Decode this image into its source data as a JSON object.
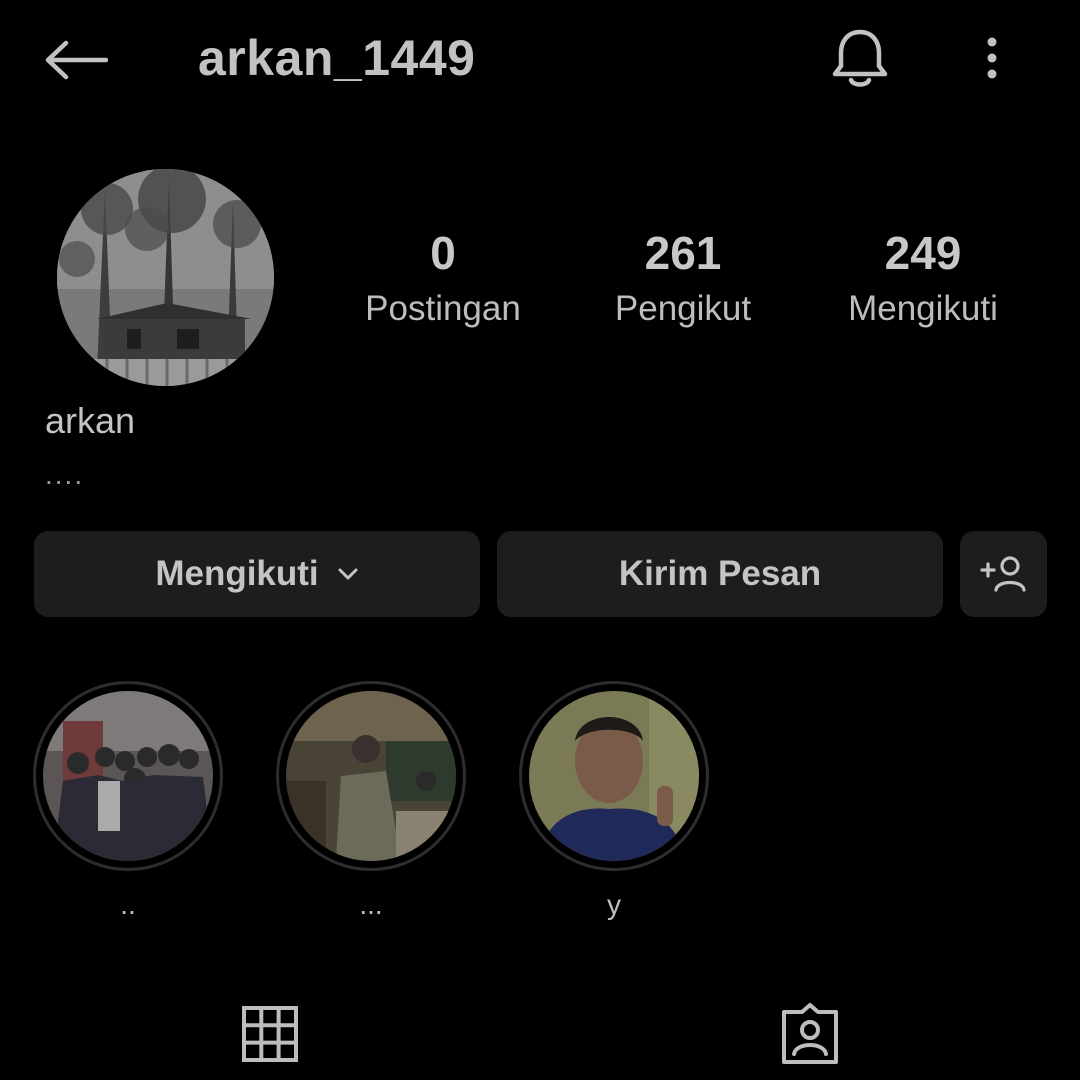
{
  "header": {
    "username": "arkan_1449",
    "icons": {
      "back": "arrow-left-icon",
      "bell": "bell-icon",
      "more": "more-vertical-icon"
    }
  },
  "profile": {
    "display_name": "arkan",
    "bio": "....",
    "avatar": "profile-photo-house-trees"
  },
  "stats": [
    {
      "value": "0",
      "label": "Postingan"
    },
    {
      "value": "261",
      "label": "Pengikut"
    },
    {
      "value": "249",
      "label": "Mengikuti"
    }
  ],
  "actions": {
    "following_label": "Mengikuti",
    "message_label": "Kirim Pesan",
    "icons": {
      "following": "chevron-down-icon",
      "add_user": "add-user-icon"
    }
  },
  "highlights": [
    {
      "label": "..",
      "thumb": "group-of-friends-photo"
    },
    {
      "label": "...",
      "thumb": "people-at-table-photo"
    },
    {
      "label": "y",
      "thumb": "selfie-photo"
    }
  ],
  "tabs": [
    {
      "name": "grid",
      "icon": "grid-icon"
    },
    {
      "name": "tagged",
      "icon": "tagged-person-icon"
    }
  ],
  "colors": {
    "background": "#000000",
    "button_bg": "#1d1d1d",
    "text": "#bdbdbd"
  }
}
